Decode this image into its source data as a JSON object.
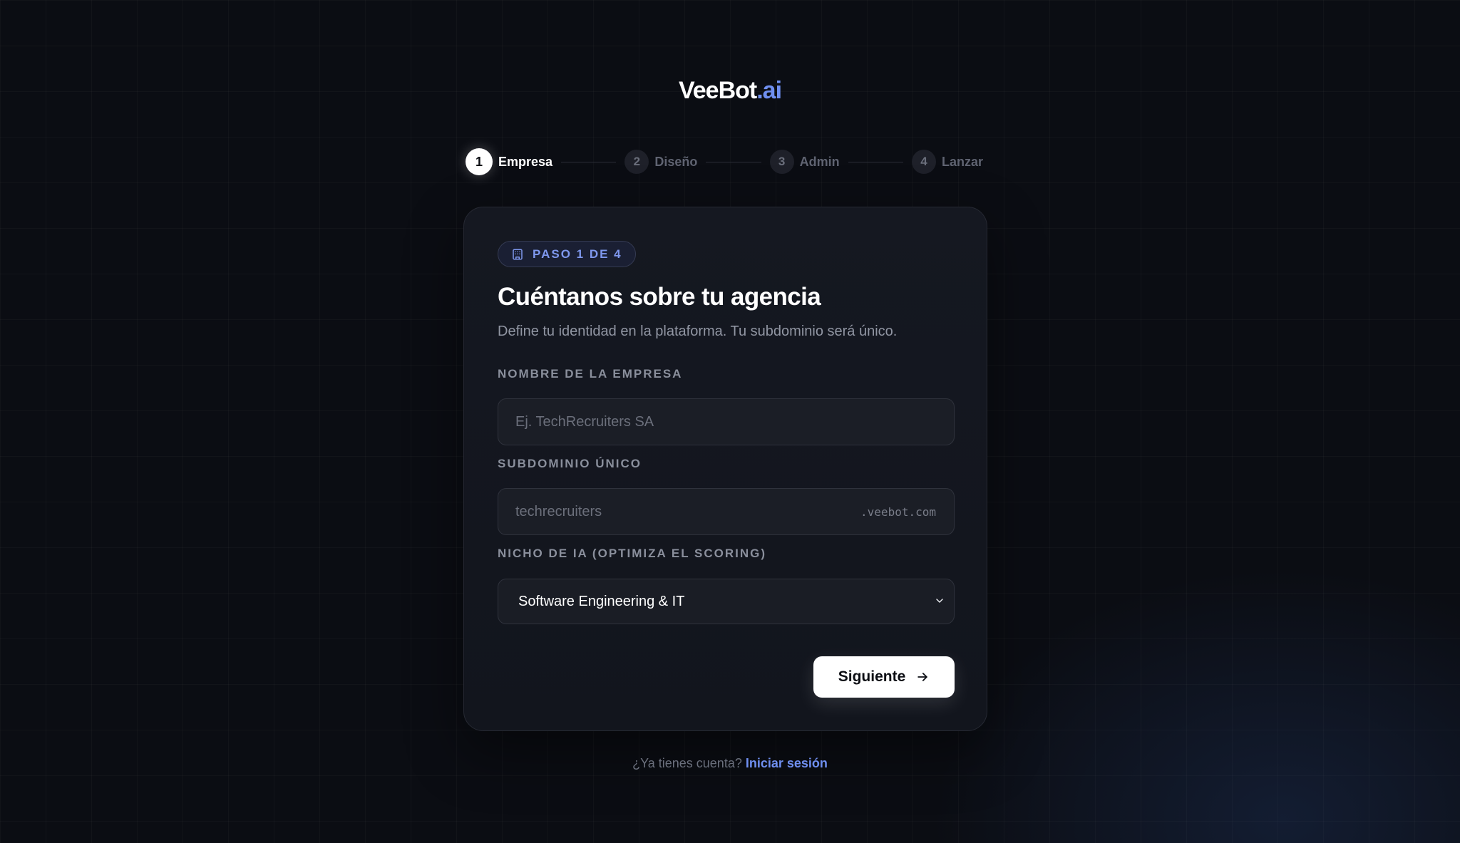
{
  "brand": {
    "name": "VeeBot",
    "suffix": ".ai"
  },
  "stepper": {
    "steps": [
      {
        "number": "1",
        "label": "Empresa",
        "state": "active"
      },
      {
        "number": "2",
        "label": "Diseño",
        "state": "inactive"
      },
      {
        "number": "3",
        "label": "Admin",
        "state": "inactive"
      },
      {
        "number": "4",
        "label": "Lanzar",
        "state": "inactive"
      }
    ]
  },
  "card": {
    "badge": {
      "icon": "building-icon",
      "text": "PASO 1 DE 4"
    },
    "title": "Cuéntanos sobre tu agencia",
    "subtitle": "Define tu identidad en la plataforma. Tu subdominio será único.",
    "fields": {
      "company_name": {
        "label": "NOMBRE DE LA EMPRESA",
        "placeholder": "Ej. TechRecruiters SA",
        "value": ""
      },
      "subdomain": {
        "label": "SUBDOMINIO ÚNICO",
        "placeholder": "techrecruiters",
        "value": "",
        "suffix": ".veebot.com"
      },
      "niche": {
        "label": "NICHO DE IA (OPTIMIZA EL SCORING)",
        "selected": "Software Engineering & IT"
      }
    },
    "next_button": {
      "label": "Siguiente",
      "icon": "arrow-right-icon"
    }
  },
  "footer": {
    "prompt": "¿Ya tienes cuenta?",
    "link": "Iniciar sesión"
  },
  "colors": {
    "accent": "#6f8ff0",
    "background": "#0b0d13",
    "card": "#151821"
  }
}
